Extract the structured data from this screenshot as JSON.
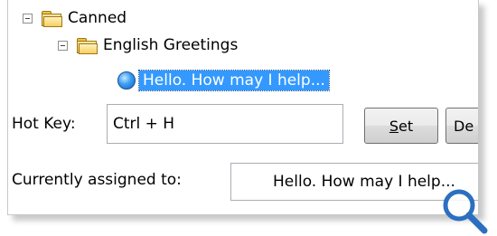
{
  "tree": {
    "root": {
      "label": "Canned"
    },
    "group": {
      "label": "English Greetings"
    },
    "item": {
      "label": "Hello.  How may I help..."
    }
  },
  "hotkey": {
    "label": "Hot Key:",
    "value": "Ctrl + H",
    "set_button_accel": "S",
    "set_button_rest": "et",
    "second_button_label": "De"
  },
  "assigned": {
    "label": "Currently assigned to:",
    "value": "Hello.  How may I help..."
  },
  "icons": {
    "expander": "minus-box-icon",
    "folder": "folder-icon",
    "node": "blue-circle-icon",
    "zoom": "magnifier-icon"
  },
  "colors": {
    "selection": "#3399ff",
    "magnifier": "#2c6fc0"
  }
}
